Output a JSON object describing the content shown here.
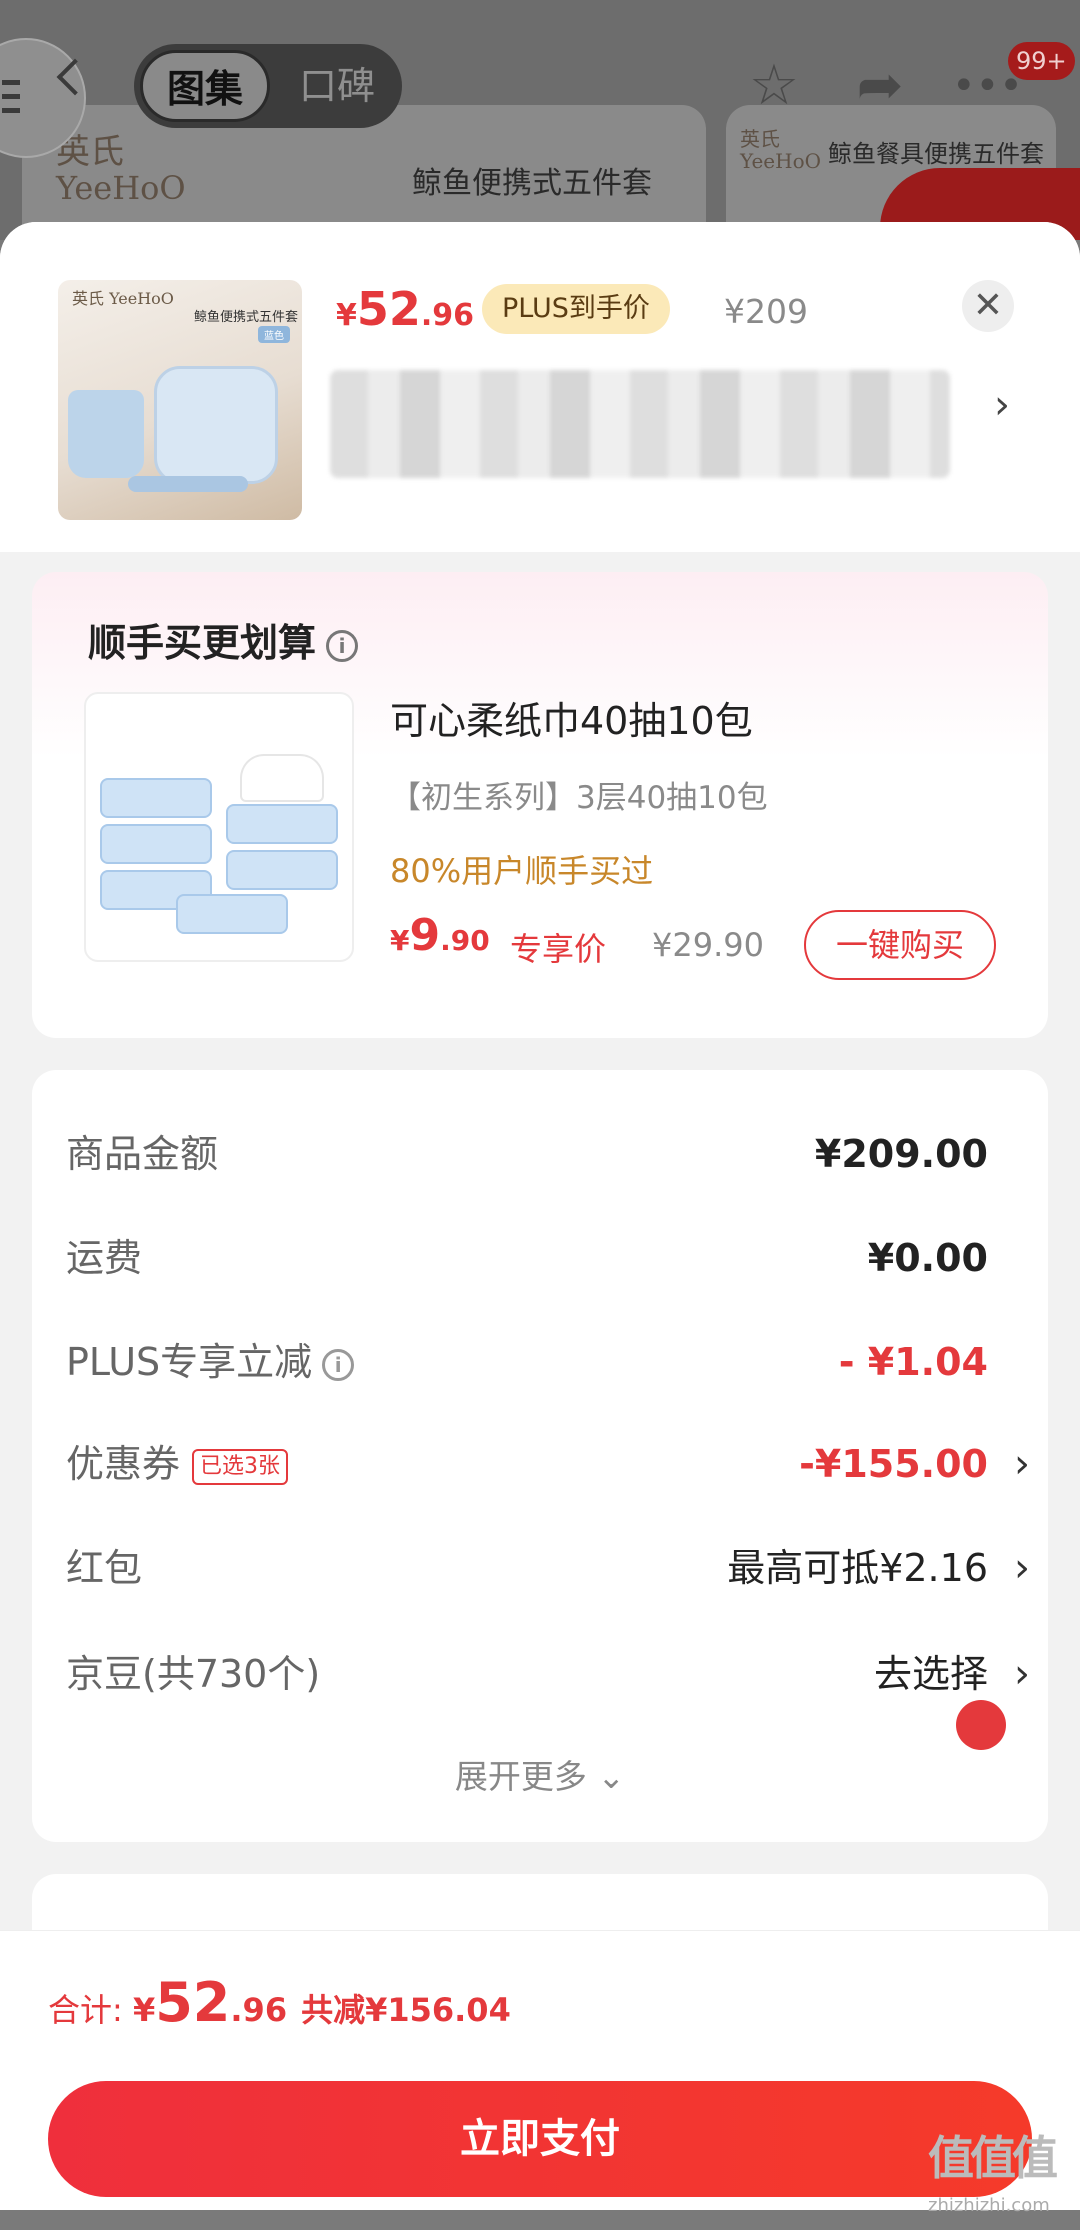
{
  "background_page": {
    "tabs": [
      "图集",
      "口碑"
    ],
    "notification_badge": "99+",
    "brand_cn": "英氏",
    "brand_en": "YeeHoO",
    "product_title": "鲸鱼便携式五件套",
    "side_product_title": "鲸鱼餐具便携五件套",
    "icons": {
      "back": "chevron-left-icon",
      "favorite": "star-icon",
      "share": "share-icon",
      "more": "more-dots-icon",
      "menu": "menu-icon"
    }
  },
  "product": {
    "thumb_brand": "英氏 YeeHoO",
    "thumb_name": "鲸鱼便携式五件套",
    "thumb_tag": "蓝色",
    "price_yen": "¥",
    "price_int": "52",
    "price_dec": ".96",
    "plus_label": "PLUS到手价",
    "original_price": "¥209",
    "close_icon": "close-icon",
    "address_arrow": "›"
  },
  "bundle": {
    "title": "顺手买更划算",
    "info_icon": "info-icon",
    "item": {
      "name": "可心柔纸巾40抽10包",
      "spec": "【初生系列】3层40抽10包",
      "stat": "80%用户顺手买过",
      "price_yen": "¥",
      "price_int": "9",
      "price_dec": ".90",
      "exclusive_label": "专享价",
      "original_price": "¥29.90",
      "buy_label": "一键购买"
    }
  },
  "fees": {
    "rows": [
      {
        "label": "商品金额",
        "value": "¥209.00"
      },
      {
        "label": "运费",
        "value": "¥0.00"
      },
      {
        "label": "PLUS专享立减",
        "value": "- ¥1.04"
      },
      {
        "label": "优惠券",
        "tag": "已选3张",
        "value": "-¥155.00"
      },
      {
        "label": "红包",
        "value": "最高可抵¥2.16"
      },
      {
        "label": "京豆(共730个)",
        "value": "去选择"
      }
    ],
    "chevron": "›",
    "expand_label": "展开更多 ⌄"
  },
  "footer": {
    "total_label": "合计: ",
    "total_yen": "¥",
    "total_int": "52",
    "total_dec": ".96",
    "discount_text": "共减¥156.04",
    "pay_label": "立即支付"
  },
  "watermark": {
    "text": "值值值",
    "sub": "zhizhizhi.com"
  },
  "colors": {
    "accent_red": "#e4393c",
    "plus_gold": "#fbe9b8",
    "stat_orange": "#c8872a"
  }
}
